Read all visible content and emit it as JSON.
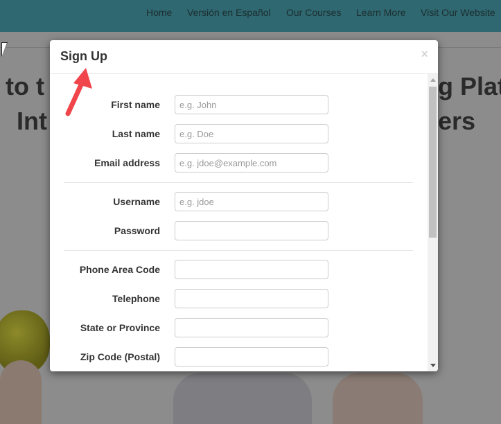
{
  "nav": {
    "items": [
      {
        "label": "Home"
      },
      {
        "label": "Versión en Español"
      },
      {
        "label": "Our Courses"
      },
      {
        "label": "Learn More"
      },
      {
        "label": "Visit Our Website"
      }
    ]
  },
  "background": {
    "heading_line1_left": "to t",
    "heading_line1_right": "g Plat",
    "heading_line2_left": "Int",
    "heading_line2_right": "ers"
  },
  "modal": {
    "title": "Sign Up",
    "close_label": "×",
    "fields": [
      {
        "label": "First name",
        "value": "",
        "placeholder": "e.g. John"
      },
      {
        "label": "Last name",
        "value": "",
        "placeholder": "e.g. Doe"
      },
      {
        "label": "Email address",
        "value": "",
        "placeholder": "e.g. jdoe@example.com"
      },
      {
        "label": "Username",
        "value": "",
        "placeholder": "e.g. jdoe"
      },
      {
        "label": "Password",
        "value": "",
        "placeholder": ""
      },
      {
        "label": "Phone Area Code",
        "value": "",
        "placeholder": ""
      },
      {
        "label": "Telephone",
        "value": "",
        "placeholder": ""
      },
      {
        "label": "State or Province",
        "value": "",
        "placeholder": ""
      },
      {
        "label": "Zip Code (Postal)",
        "value": "",
        "placeholder": ""
      }
    ]
  },
  "colors": {
    "nav_bg": "#2f6870",
    "annotation_arrow": "#f0454a"
  },
  "icons": {
    "close": "close-icon",
    "pointer": "mouse-pointer-icon",
    "annotation": "red-arrow-icon"
  }
}
